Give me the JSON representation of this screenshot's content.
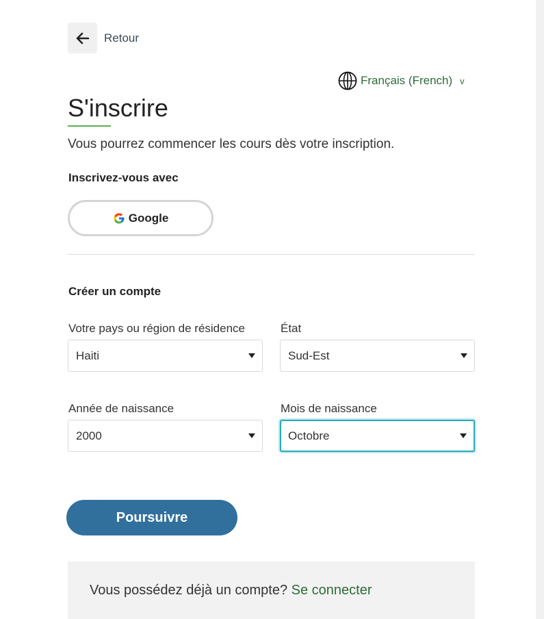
{
  "nav": {
    "back_label": "Retour"
  },
  "language": {
    "selected": "Français (French)",
    "caret": "v"
  },
  "header": {
    "title": "S'inscrire",
    "subtitle": "Vous pourrez commencer les cours dès votre inscription."
  },
  "social": {
    "heading": "Inscrivez-vous avec",
    "google_label": "Google"
  },
  "create_account": {
    "heading": "Créer un compte",
    "fields": {
      "country": {
        "label": "Votre pays ou région de résidence",
        "value": "Haiti"
      },
      "state": {
        "label": "État",
        "value": "Sud-Est"
      },
      "birth_year": {
        "label": "Année de naissance",
        "value": "2000"
      },
      "birth_month": {
        "label": "Mois de naissance",
        "value": "Octobre"
      }
    }
  },
  "actions": {
    "continue_label": "Poursuivre"
  },
  "login": {
    "prompt": "Vous possédez déjà un compte?",
    "link_label": "Se connecter"
  },
  "colors": {
    "accent_green": "#5ab04f",
    "link_green": "#2e6b3a",
    "primary_button": "#31709c",
    "focus_ring": "#2aa9b8"
  }
}
